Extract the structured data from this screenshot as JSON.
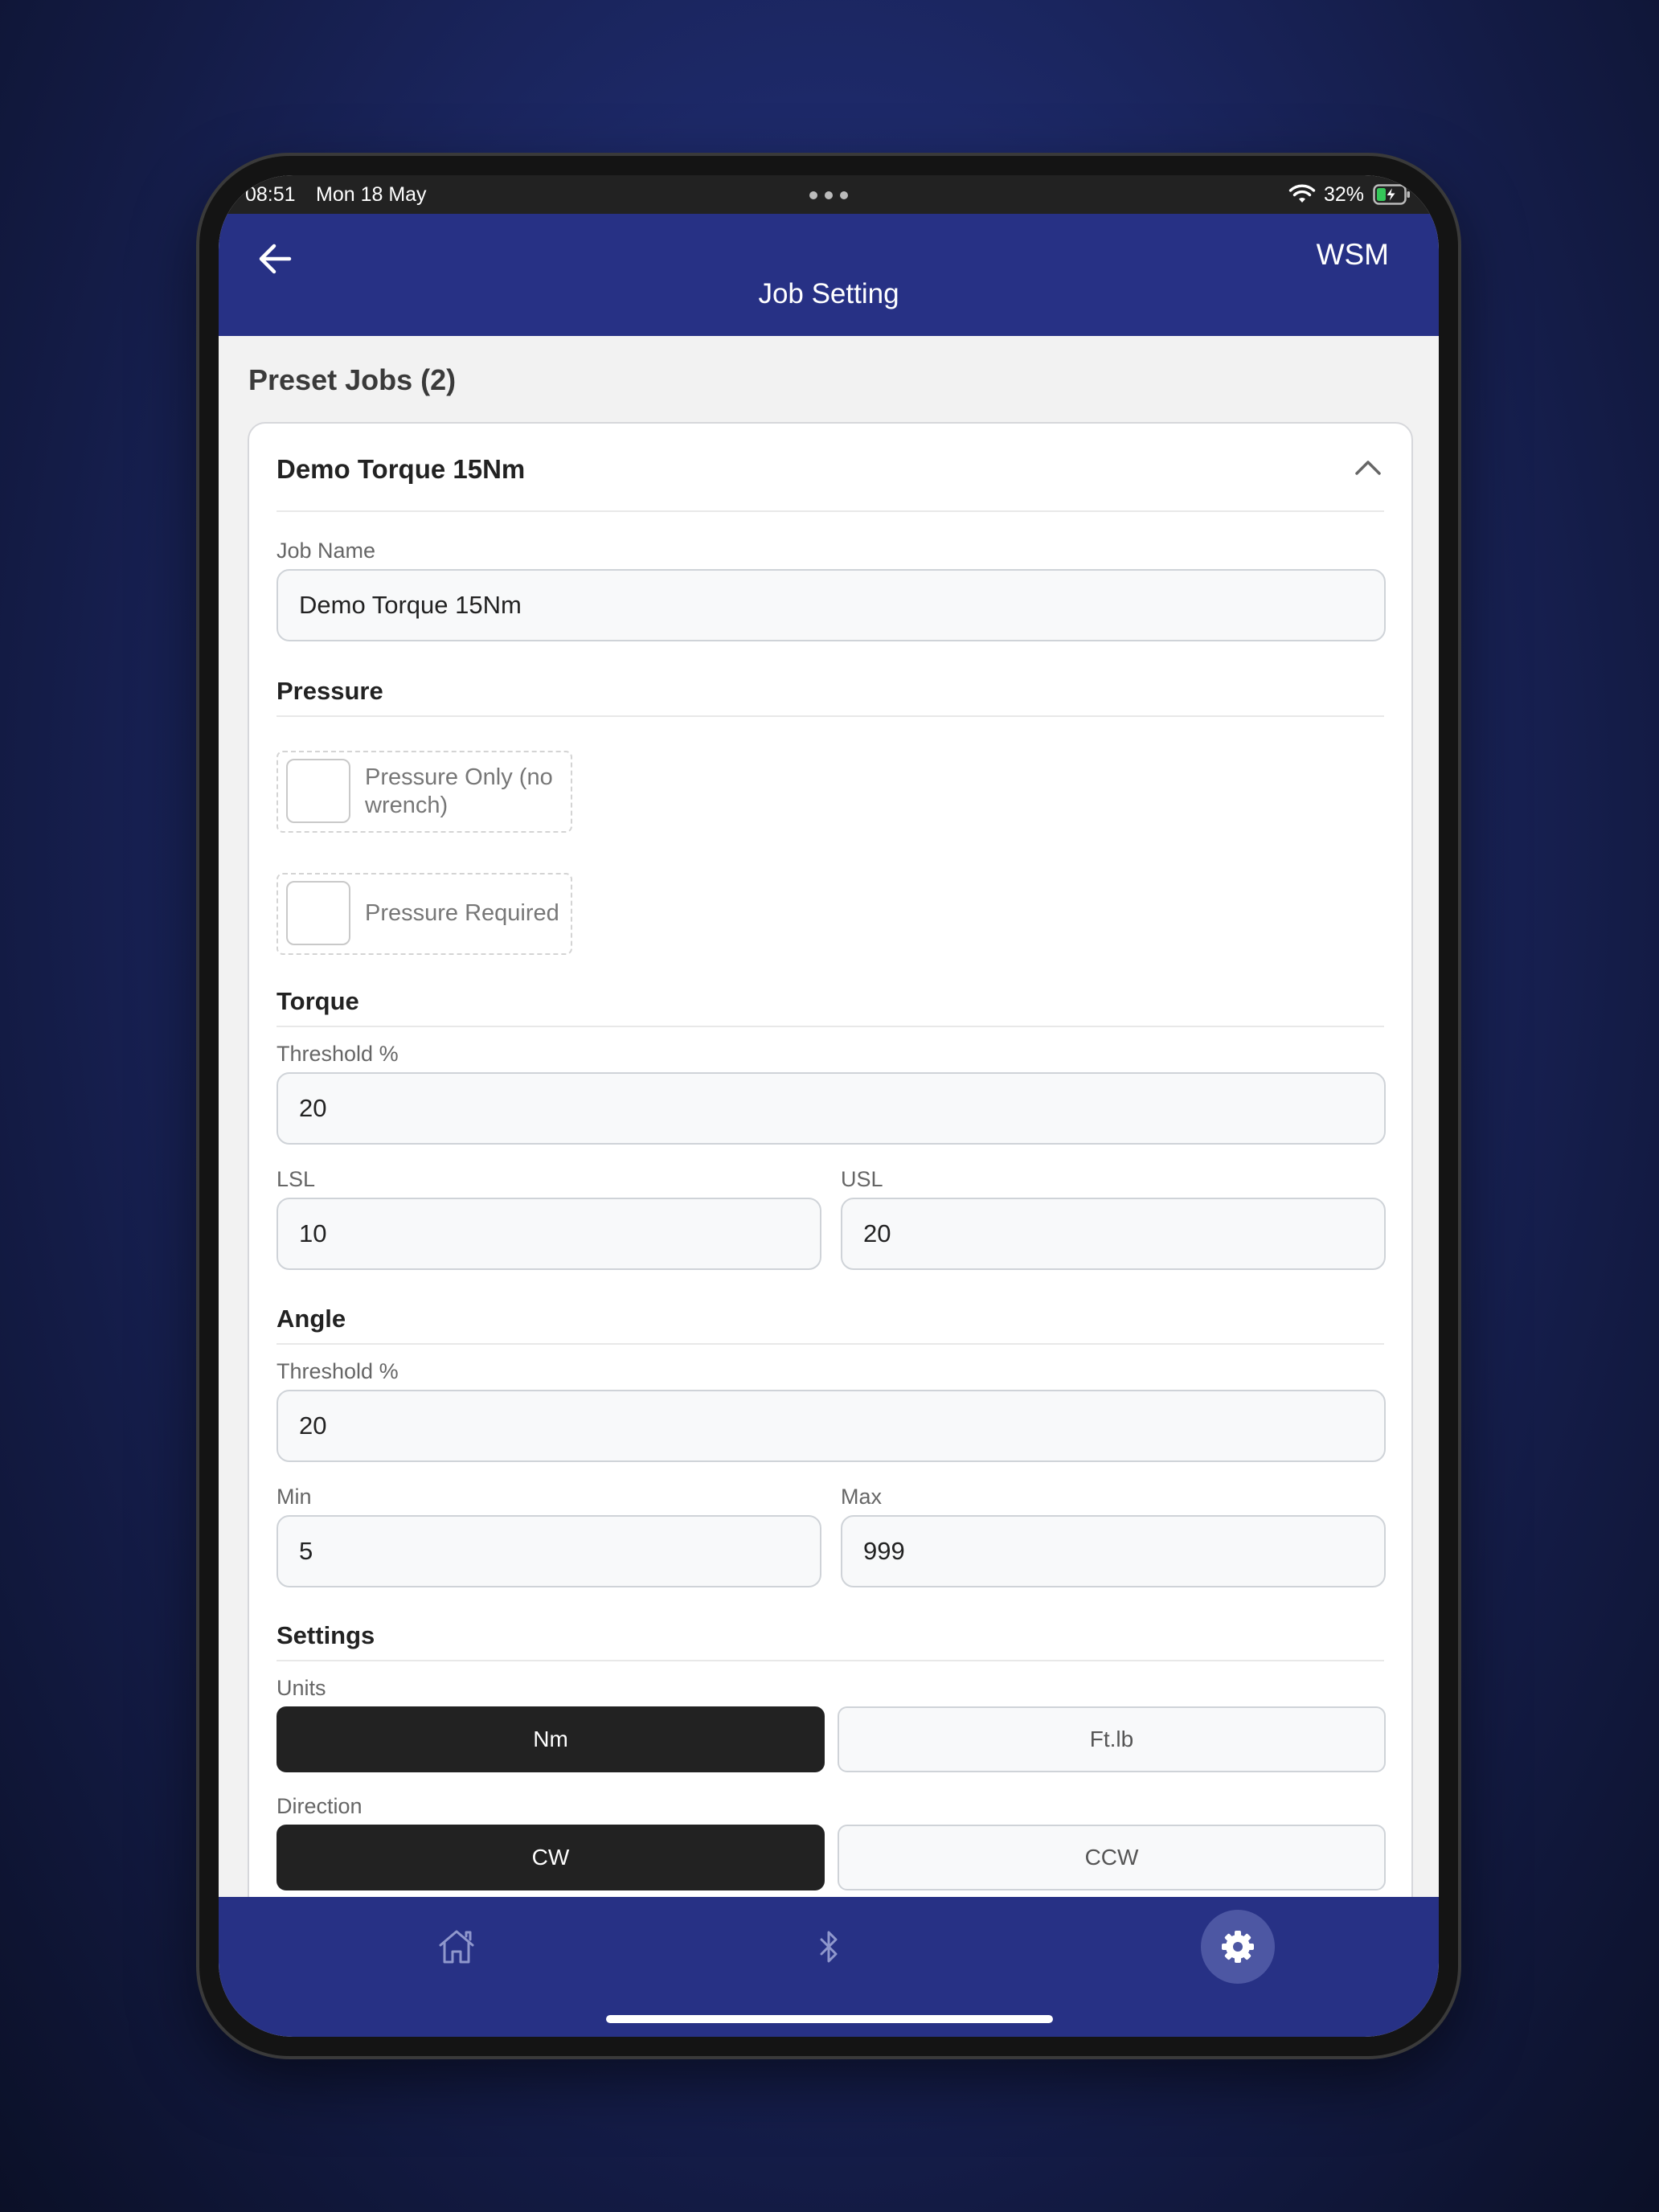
{
  "status_bar": {
    "time": "08:51",
    "date": "Mon 18 May",
    "battery_percent": "32%"
  },
  "header": {
    "title": "Job Setting",
    "brand": "WSM"
  },
  "section": {
    "title": "Preset Jobs (2)"
  },
  "job_card": {
    "title": "Demo Torque 15Nm",
    "job_name": {
      "label": "Job Name",
      "value": "Demo Torque 15Nm"
    },
    "pressure": {
      "title": "Pressure",
      "pressure_only_label": "Pressure Only (no wrench)",
      "pressure_only_checked": false,
      "pressure_required_label": "Pressure Required",
      "pressure_required_checked": false
    },
    "torque": {
      "title": "Torque",
      "threshold_label": "Threshold %",
      "threshold_value": "20",
      "lsl_label": "LSL",
      "lsl_value": "10",
      "usl_label": "USL",
      "usl_value": "20"
    },
    "angle": {
      "title": "Angle",
      "threshold_label": "Threshold %",
      "threshold_value": "20",
      "min_label": "Min",
      "min_value": "5",
      "max_label": "Max",
      "max_value": "999"
    },
    "settings": {
      "title": "Settings",
      "units_label": "Units",
      "units_options": [
        "Nm",
        "Ft.lb"
      ],
      "units_selected": "Nm",
      "direction_label": "Direction",
      "direction_options": [
        "CW",
        "CCW"
      ],
      "direction_selected": "CW"
    }
  },
  "tab_bar": {
    "tabs": [
      "home-icon",
      "bluetooth-icon",
      "gear-icon"
    ],
    "active": "gear-icon"
  },
  "colors": {
    "header_bg": "#273185",
    "selected_segment": "#222222",
    "active_tab": "#4d57a3"
  }
}
